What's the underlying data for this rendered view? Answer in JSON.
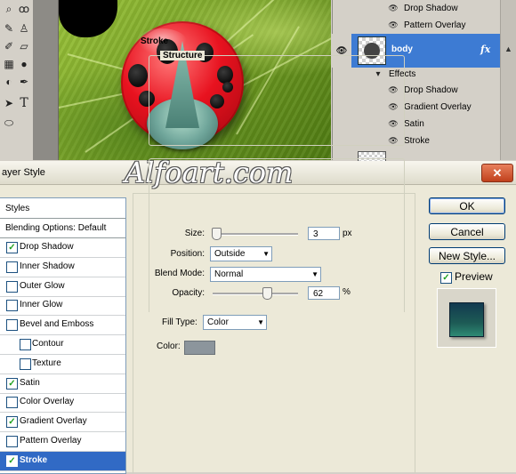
{
  "watermark": "Alfoart.com",
  "toolbox": {
    "tools": [
      {
        "icon": "magnifier-icon",
        "glyph": "⌕"
      },
      {
        "icon": "lasso-icon",
        "glyph": "ꝏ"
      },
      {
        "icon": "brush-icon",
        "glyph": "✎"
      },
      {
        "icon": "stamp-icon",
        "glyph": "♙"
      },
      {
        "icon": "history-brush-icon",
        "glyph": "✐"
      },
      {
        "icon": "eraser-icon",
        "glyph": "▱"
      },
      {
        "icon": "gradient-icon",
        "glyph": "▦"
      },
      {
        "icon": "blur-icon",
        "glyph": "●"
      },
      {
        "icon": "dodge-icon",
        "glyph": "◐"
      },
      {
        "icon": "pen-icon",
        "glyph": "✒"
      },
      {
        "icon": "path-select-icon",
        "glyph": "➤"
      },
      {
        "icon": "type-icon",
        "glyph": "T"
      },
      {
        "icon": "shape-icon",
        "glyph": "⬭"
      }
    ]
  },
  "layers": {
    "top_effects": [
      {
        "label": "Drop Shadow"
      },
      {
        "label": "Pattern Overlay"
      }
    ],
    "body_layer": {
      "name": "body",
      "fx": "fx"
    },
    "effects_label": "Effects",
    "body_effects": [
      {
        "label": "Drop Shadow"
      },
      {
        "label": "Gradient Overlay"
      },
      {
        "label": "Satin"
      },
      {
        "label": "Stroke"
      }
    ]
  },
  "dialog": {
    "title": "ayer Style",
    "close_label": "✕",
    "styles_header": "Styles",
    "blending_options": "Blending Options: Default",
    "style_items": [
      {
        "label": "Drop Shadow",
        "checked": true,
        "indent": false,
        "selected": false
      },
      {
        "label": "Inner Shadow",
        "checked": false,
        "indent": false,
        "selected": false
      },
      {
        "label": "Outer Glow",
        "checked": false,
        "indent": false,
        "selected": false
      },
      {
        "label": "Inner Glow",
        "checked": false,
        "indent": false,
        "selected": false
      },
      {
        "label": "Bevel and Emboss",
        "checked": false,
        "indent": false,
        "selected": false
      },
      {
        "label": "Contour",
        "checked": false,
        "indent": true,
        "selected": false
      },
      {
        "label": "Texture",
        "checked": false,
        "indent": true,
        "selected": false
      },
      {
        "label": "Satin",
        "checked": true,
        "indent": false,
        "selected": false
      },
      {
        "label": "Color Overlay",
        "checked": false,
        "indent": false,
        "selected": false
      },
      {
        "label": "Gradient Overlay",
        "checked": true,
        "indent": false,
        "selected": false
      },
      {
        "label": "Pattern Overlay",
        "checked": false,
        "indent": false,
        "selected": false
      },
      {
        "label": "Stroke",
        "checked": true,
        "indent": false,
        "selected": true
      }
    ],
    "stroke": {
      "title": "Stroke",
      "structure_title": "Structure",
      "size_label": "Size:",
      "size_value": "3",
      "size_unit": "px",
      "size_slider_fraction": 0.0,
      "position_label": "Position:",
      "position_value": "Outside",
      "blend_mode_label": "Blend Mode:",
      "blend_mode_value": "Normal",
      "opacity_label": "Opacity:",
      "opacity_value": "62",
      "opacity_unit": "%",
      "opacity_slider_fraction": 0.62,
      "fill_type_label": "Fill Type:",
      "fill_type_value": "Color",
      "color_label": "Color:",
      "color_value": "#8c959c"
    },
    "buttons": {
      "ok": "OK",
      "cancel": "Cancel",
      "new_style": "New Style..."
    },
    "preview_label": "Preview",
    "preview_checked": true
  }
}
